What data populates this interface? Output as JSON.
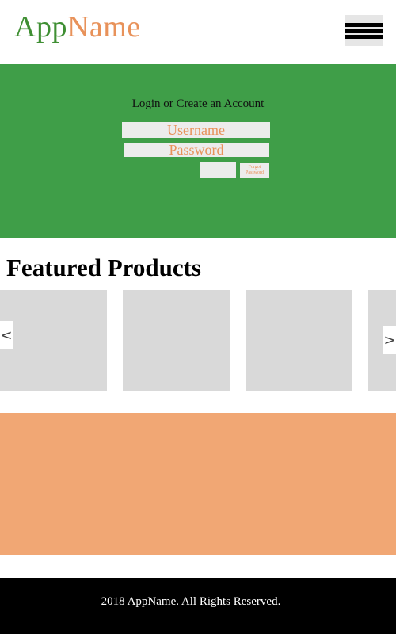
{
  "header": {
    "logo_part1": "App",
    "logo_part2": "Name"
  },
  "login": {
    "title": "Login or Create an Account",
    "username_placeholder": "Username",
    "password_placeholder": "Password",
    "forgot_label_line1": "Forgot",
    "forgot_label_line2": "Password"
  },
  "featured": {
    "title": "Featured Products",
    "prev_label": "<",
    "next_label": ">"
  },
  "footer": {
    "text": "2018 AppName. All Rights Reserved."
  },
  "colors": {
    "brand_green": "#3f9e48",
    "brand_orange": "#f1a774",
    "logo_green": "#3f8f33",
    "logo_orange": "#e8925a"
  }
}
